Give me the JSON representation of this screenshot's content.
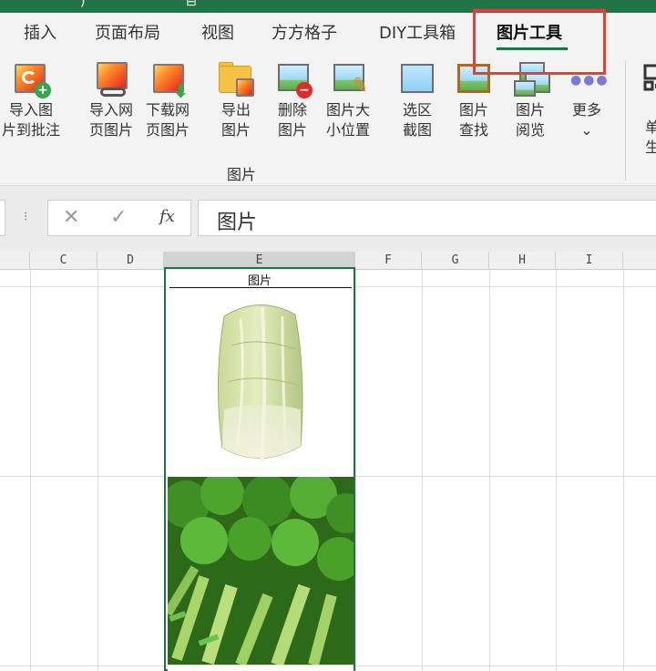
{
  "title_strip": {
    "glyphs": [
      ")",
      "⊟"
    ]
  },
  "tabs": [
    {
      "label": "插入"
    },
    {
      "label": "页面布局"
    },
    {
      "label": "视图"
    },
    {
      "label": "方方格子"
    },
    {
      "label": "DIY工具箱"
    },
    {
      "label": "图片工具",
      "active": true
    }
  ],
  "ribbon": {
    "buttons": [
      {
        "label_line1": "导入图",
        "label_line2": "片到批注",
        "icon": "import-picture-to-comment-icon"
      },
      {
        "label_line1": "导入网",
        "label_line2": "页图片",
        "icon": "import-web-picture-icon"
      },
      {
        "label_line1": "下载网",
        "label_line2": "页图片",
        "icon": "download-web-picture-icon"
      },
      {
        "label_line1": "导出",
        "label_line2": "图片",
        "icon": "export-picture-icon"
      },
      {
        "label_line1": "删除",
        "label_line2": "图片",
        "icon": "delete-picture-icon"
      },
      {
        "label_line1": "图片大",
        "label_line2": "小位置",
        "icon": "picture-size-position-icon"
      },
      {
        "label_line1": "选区",
        "label_line2": "截图",
        "icon": "selection-screenshot-icon"
      },
      {
        "label_line1": "图片",
        "label_line2": "查找",
        "icon": "picture-find-icon"
      },
      {
        "label_line1": "图片",
        "label_line2": "阅览",
        "icon": "picture-browse-icon"
      },
      {
        "label_line1": "更多",
        "label_line2": "⌄",
        "icon": "more-dots-icon"
      }
    ],
    "group_label": "图片",
    "cut_label_1": "单",
    "cut_label_2": "生"
  },
  "formula_bar": {
    "separator": "⁝",
    "cancel": "✕",
    "enter": "✓",
    "fx": "fx",
    "value": "图片"
  },
  "columns": [
    "C",
    "D",
    "E",
    "F",
    "G",
    "H",
    "I"
  ],
  "cell_e1": "图片",
  "colors": {
    "accent": "#217346",
    "highlight": "#e0413a"
  }
}
